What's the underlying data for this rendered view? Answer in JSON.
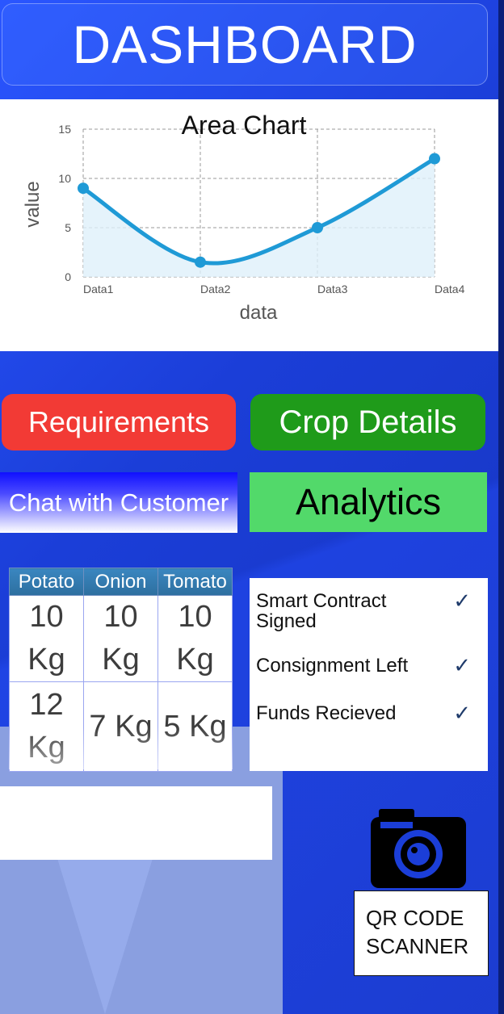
{
  "header": {
    "title": "DASHBOARD"
  },
  "chart_data": {
    "type": "area",
    "title": "Area Chart",
    "xlabel": "data",
    "ylabel": "value",
    "categories": [
      "Data1",
      "Data2",
      "Data3",
      "Data4"
    ],
    "values": [
      9,
      1.5,
      5,
      12
    ],
    "ylim": [
      0,
      15
    ],
    "yticks": [
      0,
      5,
      10,
      15
    ],
    "grid": true,
    "color": "#1f9ad6"
  },
  "buttons": {
    "requirements": "Requirements",
    "crop_details": "Crop Details",
    "chat": "Chat with Customer",
    "analytics": "Analytics"
  },
  "stock_table": {
    "headers": [
      "Potato",
      "Onion",
      "Tomato"
    ],
    "rows": [
      [
        "10 Kg",
        "10 Kg",
        "10 Kg"
      ],
      [
        "12 Kg",
        "7 Kg",
        "5 Kg"
      ]
    ]
  },
  "status": {
    "items": [
      {
        "label": "Smart Contract Signed",
        "check": "✓"
      },
      {
        "label": "Consignment Left",
        "check": "✓"
      },
      {
        "label": "Funds Recieved",
        "check": "✓"
      }
    ]
  },
  "input": {
    "value": ""
  },
  "qr": {
    "label": "QR CODE SCANNER",
    "icon": "camera-icon"
  },
  "colors": {
    "requirements": "#f23a35",
    "crop_details": "#1f9b1a",
    "analytics": "#52d96a",
    "background": "#1c3fd1"
  }
}
